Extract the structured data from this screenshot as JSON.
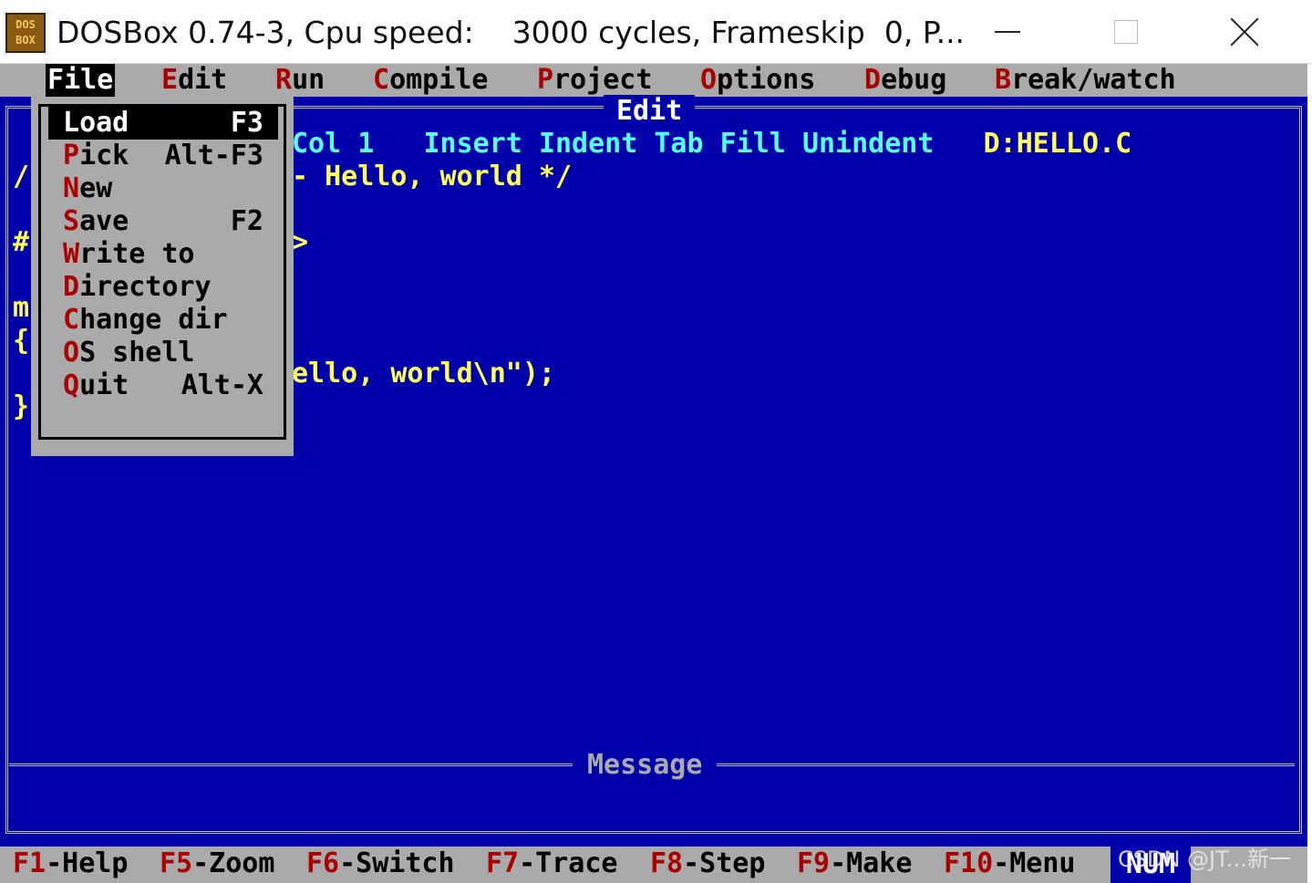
{
  "window": {
    "icon_line1": "DOS",
    "icon_line2": "BOX",
    "title": "DOSBox 0.74-3, Cpu speed:    3000 cycles, Frameskip  0, P..."
  },
  "menubar": [
    {
      "hot": "F",
      "rest": "ile"
    },
    {
      "hot": "E",
      "rest": "dit"
    },
    {
      "hot": "R",
      "rest": "un"
    },
    {
      "hot": "C",
      "rest": "ompile"
    },
    {
      "hot": "P",
      "rest": "roject"
    },
    {
      "hot": "O",
      "rest": "ptions"
    },
    {
      "hot": "D",
      "rest": "ebug"
    },
    {
      "hot": "B",
      "rest": "reak/watch"
    }
  ],
  "editor": {
    "title": "Edit",
    "status": {
      "col": "Col 1",
      "mode1": "Insert",
      "mode2": "Indent",
      "mode3": "Tab",
      "mode4": "Fill",
      "mode5": "Unindent",
      "file": "D:HELLO.C"
    },
    "code": [
      {
        "prefix": "/",
        "text": "- Hello, world */"
      },
      {
        "prefix": "#",
        "text": ">"
      },
      {
        "prefix": "m",
        "text": ""
      },
      {
        "prefix": "{",
        "text": ""
      },
      {
        "prefix": "",
        "text": "ello, world\\n\");"
      },
      {
        "prefix": "}",
        "text": ""
      }
    ],
    "message_title": "Message"
  },
  "file_menu": [
    {
      "hot": "L",
      "rest": "oad",
      "key": "F3",
      "selected": true
    },
    {
      "hot": "P",
      "rest": "ick",
      "key": "Alt-F3"
    },
    {
      "hot": "N",
      "rest": "ew",
      "key": ""
    },
    {
      "hot": "S",
      "rest": "ave",
      "key": "F2"
    },
    {
      "hot": "W",
      "rest": "rite to",
      "key": ""
    },
    {
      "hot": "D",
      "rest": "irectory",
      "key": ""
    },
    {
      "hot": "C",
      "rest": "hange dir",
      "key": ""
    },
    {
      "hot": "O",
      "rest": "S shell",
      "key": ""
    },
    {
      "hot": "Q",
      "rest": "uit",
      "key": "Alt-X"
    }
  ],
  "fkeys": [
    {
      "key": "F1",
      "label": "-Help"
    },
    {
      "key": "F5",
      "label": "-Zoom"
    },
    {
      "key": "F6",
      "label": "-Switch"
    },
    {
      "key": "F7",
      "label": "-Trace"
    },
    {
      "key": "F8",
      "label": "-Step"
    },
    {
      "key": "F9",
      "label": "-Make"
    },
    {
      "key": "F10",
      "label": "-Menu"
    }
  ],
  "num_badge": "NUM",
  "watermark": "CSDN @JT...新一",
  "colors": {
    "screen_blue": "#0000aa",
    "menu_gray": "#aaaaaa",
    "hotkey_red": "#aa0000",
    "code_yellow": "#ffff55",
    "status_cyan": "#55ffff"
  }
}
